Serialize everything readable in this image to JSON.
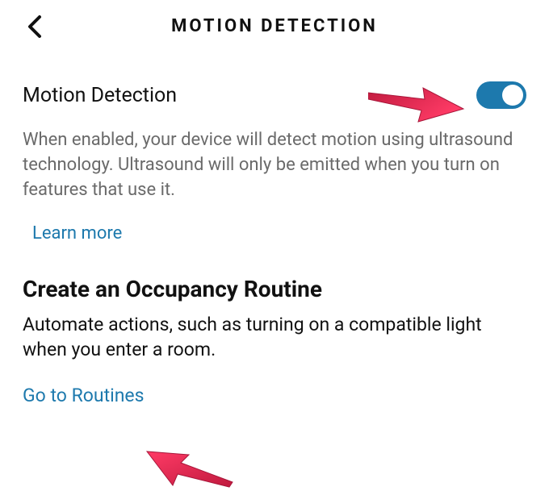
{
  "header": {
    "title": "MOTION DETECTION"
  },
  "motion": {
    "label": "Motion Detection",
    "toggle_on": true,
    "description": "When enabled, your device will detect motion using ultrasound technology. Ultrasound will only be emitted when you turn on features that use it.",
    "learn_more": "Learn more"
  },
  "routine": {
    "heading": "Create an Occupancy Routine",
    "description": "Automate actions, such as turning on a compatible light when you enter a room.",
    "link": "Go to Routines"
  },
  "colors": {
    "accent": "#1d79ad",
    "arrow": "#d9204b"
  }
}
